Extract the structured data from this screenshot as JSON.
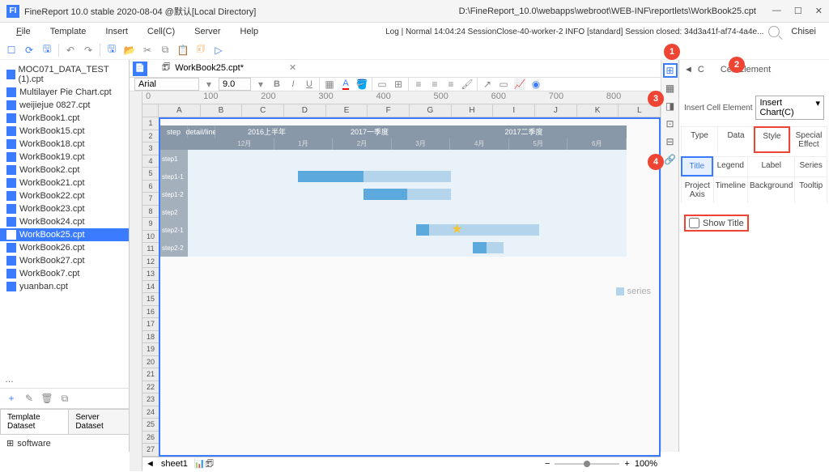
{
  "titlebar": {
    "app_name": "FineReport 10.0 stable 2020-08-04 @默认[Local Directory]",
    "file_path": "D:\\FineReport_10.0\\webapps\\webroot\\WEB-INF\\reportlets\\WorkBook25.cpt",
    "user": "Chisei"
  },
  "menubar": {
    "file": "File",
    "template": "Template",
    "insert": "Insert",
    "cell": "Cell(C)",
    "server": "Server",
    "help": "Help",
    "log": "Log | Normal 14:04:24 SessionClose-40-worker-2 INFO [standard] Session closed: 34d3a41f-af74-4a4e..."
  },
  "files": [
    "MOC071_DATA_TEST (1).cpt",
    "Multilayer Pie Chart.cpt",
    "weijiejue 0827.cpt",
    "WorkBook1.cpt",
    "WorkBook15.cpt",
    "WorkBook18.cpt",
    "WorkBook19.cpt",
    "WorkBook2.cpt",
    "WorkBook21.cpt",
    "WorkBook22.cpt",
    "WorkBook23.cpt",
    "WorkBook24.cpt",
    "WorkBook25.cpt",
    "WorkBook26.cpt",
    "WorkBook27.cpt",
    "WorkBook7.cpt",
    "yuanban.cpt"
  ],
  "file_selected": "WorkBook25.cpt",
  "ds": {
    "template_tab": "Template Dataset",
    "server_tab": "Server Dataset",
    "item": "software"
  },
  "doc": {
    "tab_label": "WorkBook25.cpt*"
  },
  "format": {
    "font": "Arial",
    "size": "9.0"
  },
  "ruler": [
    "0",
    "100",
    "200",
    "300",
    "400",
    "500",
    "600",
    "700",
    "800"
  ],
  "cols": [
    "A",
    "B",
    "C",
    "D",
    "E",
    "F",
    "G",
    "H",
    "I",
    "J",
    "K",
    "L"
  ],
  "rows_count": 27,
  "gantt": {
    "col1": "step",
    "col2": "detail/line",
    "periods": [
      "2016上半年",
      "2017一季度",
      "2017二季度"
    ],
    "subs": [
      "12月",
      "1月",
      "2月",
      "3月",
      "4月",
      "5月",
      "6月"
    ],
    "rows": [
      "step1",
      "step1-1",
      "step1-2",
      "step2",
      "step2-1",
      "step2-2"
    ],
    "legend": "series"
  },
  "sheet": {
    "name": "sheet1",
    "zoom": "100%"
  },
  "props": {
    "title": "Cell Element",
    "insert_label": "Insert Cell Element",
    "combo": "Insert Chart(C)",
    "tabs": [
      "Type",
      "Data",
      "Style",
      "Special Effect"
    ],
    "style_tabs": [
      "Title",
      "Legend",
      "Label",
      "Series",
      "Project Axis",
      "Timeline",
      "Background",
      "Tooltip"
    ],
    "show_title": "Show Title"
  },
  "badges": [
    "1",
    "2",
    "3",
    "4"
  ],
  "chart_data": {
    "type": "bar",
    "title": "",
    "categories": [
      "step1",
      "step1-1",
      "step1-2",
      "step2",
      "step2-1",
      "step2-2"
    ],
    "series": [
      {
        "name": "series",
        "values": [
          {
            "start": 0,
            "end": 0
          },
          {
            "start": 25,
            "end": 60,
            "fill": 40
          },
          {
            "start": 40,
            "end": 60,
            "fill": 50
          },
          {
            "start": 0,
            "end": 0
          },
          {
            "start": 52,
            "end": 80,
            "fill": 55,
            "milestone": true
          },
          {
            "start": 65,
            "end": 72,
            "fill": 68
          }
        ]
      }
    ],
    "xlabel": "",
    "ylabel": ""
  }
}
